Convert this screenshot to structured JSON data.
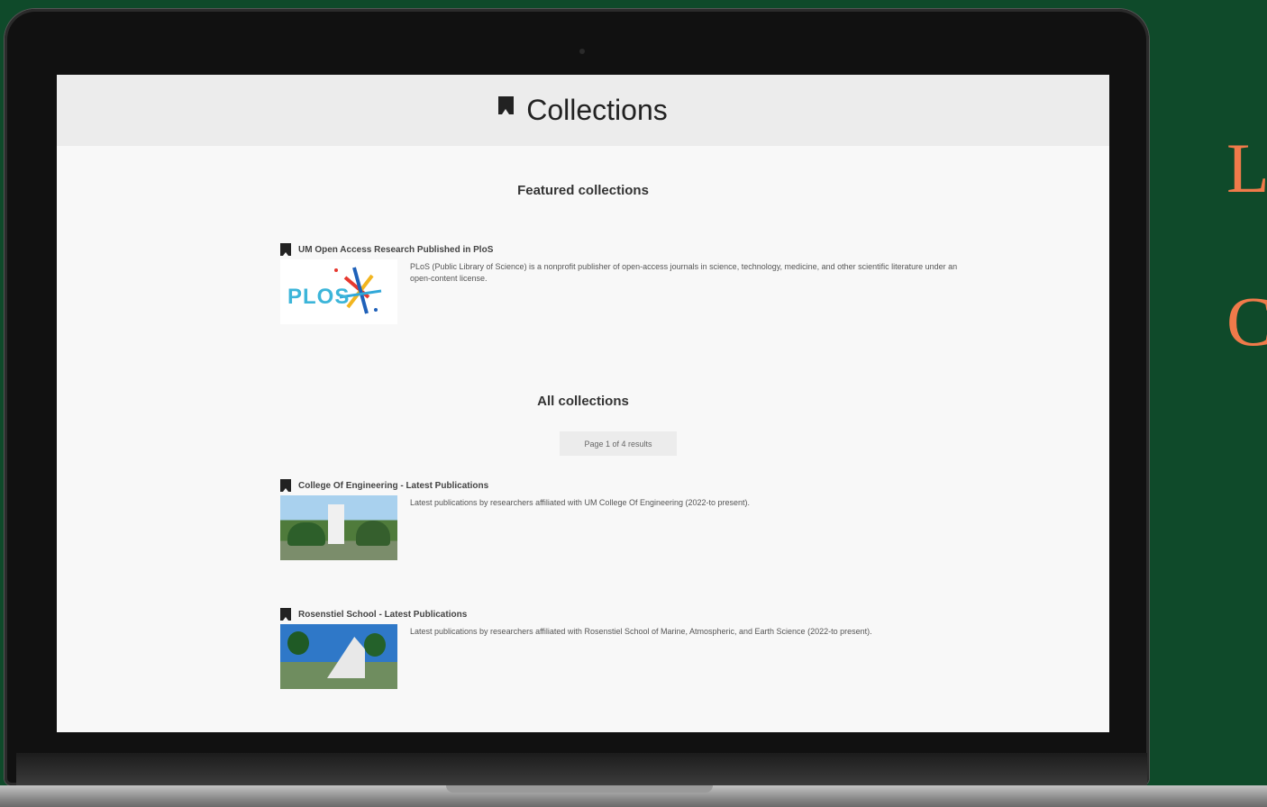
{
  "page": {
    "title": "Collections",
    "featured_heading": "Featured collections",
    "all_heading": "All collections",
    "pager_text": "Page 1 of 4 results"
  },
  "featured": [
    {
      "title": "UM Open Access Research Published in PloS",
      "description": "PLoS (Public Library of Science) is a nonprofit publisher of open-access journals in science, technology, medicine, and other scientific literature under an open-content license.",
      "thumbnail_text": "PLOS"
    }
  ],
  "collections": [
    {
      "title": "College Of Engineering - Latest Publications",
      "description": "Latest publications by researchers affiliated with UM College Of Engineering (2022-to present)."
    },
    {
      "title": "Rosenstiel School - Latest Publications",
      "description": "Latest publications by researchers affiliated with Rosenstiel School of Marine, Atmospheric, and Earth Science (2022-to present)."
    }
  ],
  "side_text": {
    "letter1": "L",
    "letter2": "C"
  }
}
